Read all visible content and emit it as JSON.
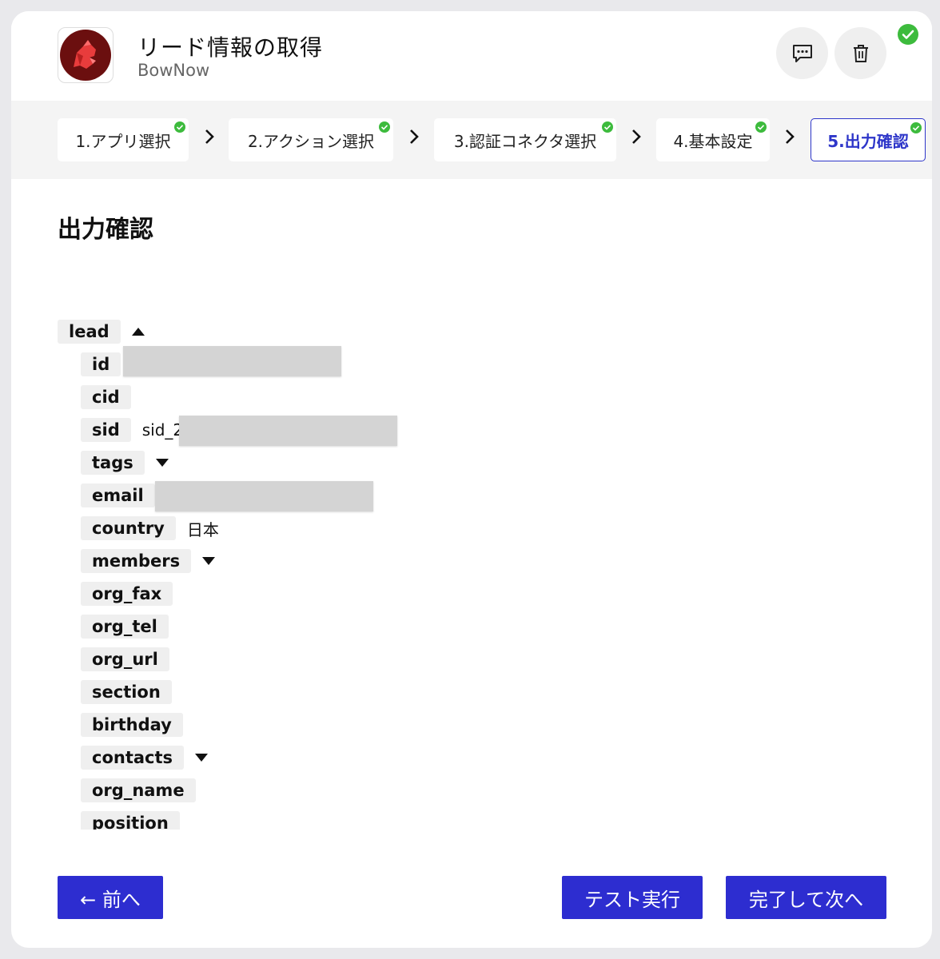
{
  "header": {
    "title": "リード情報の取得",
    "subtitle": "BowNow",
    "logo_icon": "bownow-dog-logo",
    "comment_icon": "comment-icon",
    "delete_icon": "trash-icon",
    "status": "completed"
  },
  "steps": [
    {
      "label": "1.アプリ選択",
      "done": true
    },
    {
      "label": "2.アクション選択",
      "done": true
    },
    {
      "label": "3.認証コネクタ選択",
      "done": true
    },
    {
      "label": "4.基本設定",
      "done": true
    },
    {
      "label": "5.出力確認",
      "done": true,
      "active": true
    }
  ],
  "section_title": "出力確認",
  "tree": {
    "root": {
      "key": "lead",
      "expanded": true
    },
    "fields": [
      {
        "key": "id",
        "value": "",
        "masked": true
      },
      {
        "key": "cid",
        "value": ""
      },
      {
        "key": "sid",
        "value": "sid_2",
        "masked": true
      },
      {
        "key": "tags",
        "collapsed": true
      },
      {
        "key": "email",
        "value": "",
        "masked": true
      },
      {
        "key": "country",
        "value": "日本"
      },
      {
        "key": "members",
        "collapsed": true
      },
      {
        "key": "org_fax",
        "value": ""
      },
      {
        "key": "org_tel",
        "value": ""
      },
      {
        "key": "org_url",
        "value": ""
      },
      {
        "key": "section",
        "value": ""
      },
      {
        "key": "birthday",
        "value": ""
      },
      {
        "key": "contacts",
        "collapsed": true
      },
      {
        "key": "org_name",
        "value": ""
      },
      {
        "key": "position",
        "value": ""
      }
    ]
  },
  "footer": {
    "back_label": "← 前へ",
    "test_label": "テスト実行",
    "finish_label": "完了して次へ"
  },
  "colors": {
    "primary": "#2d2dd0",
    "success": "#3dbb3d",
    "key_bg": "#efefef",
    "mask": "#d4d4d4"
  }
}
